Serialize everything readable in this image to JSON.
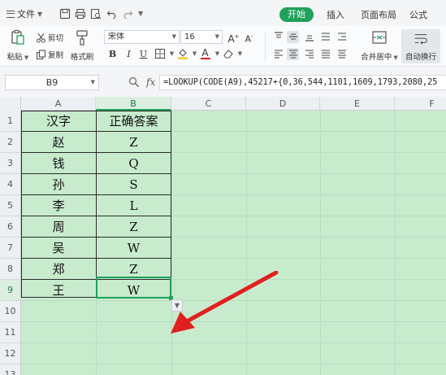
{
  "toolbar": {
    "file_label": "文件",
    "tabs": [
      "开始",
      "插入",
      "页面布局",
      "公式"
    ],
    "active_tab": "开始",
    "accent_color": "#1fa15a"
  },
  "ribbon": {
    "paste_label": "粘贴",
    "cut_label": "剪切",
    "copy_label": "复制",
    "format_painter_label": "格式刷",
    "font_name": "宋体",
    "font_size": "16",
    "bold": "B",
    "italic": "I",
    "underline": "U",
    "merge_center_label": "合并居中",
    "wrap_text_label": "自动换行"
  },
  "formula_bar": {
    "name_box": "B9",
    "fx_label": "fx",
    "formula": "=LOOKUP(CODE(A9),45217+{0,36,544,1101,1609,1793,2080,25"
  },
  "sheet": {
    "columns": [
      "A",
      "B",
      "C",
      "D",
      "E",
      "F"
    ],
    "active_column": "B",
    "rows": [
      "1",
      "2",
      "3",
      "4",
      "5",
      "6",
      "7",
      "8",
      "9",
      "10",
      "11",
      "12",
      "13"
    ],
    "active_row": "9",
    "header": {
      "a": "汉字",
      "b": "正确答案"
    },
    "data": [
      {
        "a": "赵",
        "b": "Z"
      },
      {
        "a": "钱",
        "b": "Q"
      },
      {
        "a": "孙",
        "b": "S"
      },
      {
        "a": "李",
        "b": "L"
      },
      {
        "a": "周",
        "b": "Z"
      },
      {
        "a": "吴",
        "b": "W"
      },
      {
        "a": "郑",
        "b": "Z"
      },
      {
        "a": "王",
        "b": "W"
      }
    ],
    "grid_color": "#c8ebce",
    "annotation_arrow_color": "#e02020"
  }
}
